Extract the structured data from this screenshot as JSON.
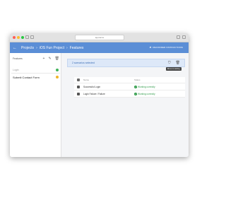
{
  "window": {
    "address": "appname"
  },
  "appbar": {
    "breadcrumbs": [
      "Projects",
      "iOS Fun Project",
      "Features"
    ],
    "right_action": "Recorder Instructions"
  },
  "sidebar": {
    "header": "Features",
    "items": [
      {
        "label": "Login",
        "status_color": "#3fb35b"
      },
      {
        "label": "Submit Contact Form",
        "status_color": "#f0b429"
      }
    ]
  },
  "main": {
    "selection_text": "2 scenarios selected",
    "tooltip": "Move to testing",
    "table": {
      "columns": [
        "Name",
        "Status"
      ],
      "rows": [
        {
          "name": "Successful Login",
          "status": "Working correctly"
        },
        {
          "name": "Login Failure / Failure",
          "status": "Working correctly"
        }
      ]
    }
  },
  "colors": {
    "appbar": "#5b8ed6",
    "selection_bg": "#dde8f8",
    "success": "#2e9b48"
  }
}
